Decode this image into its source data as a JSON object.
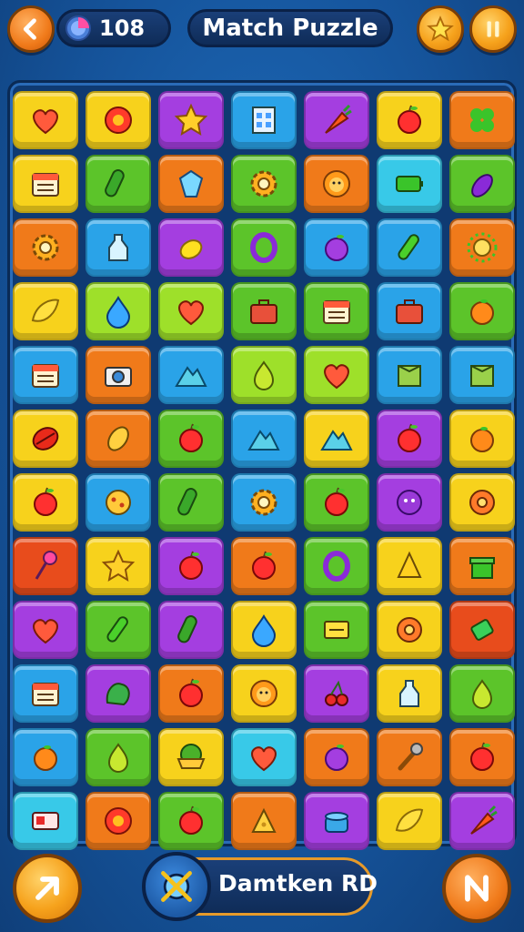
{
  "header": {
    "coins": "108",
    "title": "Match Puzzle"
  },
  "footer": {
    "player_name": "Damtken RD"
  },
  "colors": {
    "yellow": "#f7d21c",
    "orange": "#f07a1a",
    "purple": "#a43ee0",
    "blue": "#2aa3e8",
    "green": "#5cc42a",
    "red": "#e84c1c",
    "lime": "#9ee02a",
    "cyan": "#38c9e8"
  },
  "tiles": [
    [
      {
        "c": "yellow",
        "i": "heart-icon"
      },
      {
        "c": "yellow",
        "i": "flower-icon"
      },
      {
        "c": "purple",
        "i": "star-icon"
      },
      {
        "c": "blue",
        "i": "building-icon"
      },
      {
        "c": "purple",
        "i": "carrot-icon"
      },
      {
        "c": "yellow",
        "i": "apple-icon"
      },
      {
        "c": "orange",
        "i": "clover-icon"
      }
    ],
    [
      {
        "c": "yellow",
        "i": "calendar-icon"
      },
      {
        "c": "green",
        "i": "cucumber-icon"
      },
      {
        "c": "orange",
        "i": "gem-icon"
      },
      {
        "c": "green",
        "i": "gear-icon"
      },
      {
        "c": "orange",
        "i": "lion-icon"
      },
      {
        "c": "cyan",
        "i": "battery-icon"
      },
      {
        "c": "green",
        "i": "eggplant-icon"
      }
    ],
    [
      {
        "c": "orange",
        "i": "gear-icon"
      },
      {
        "c": "blue",
        "i": "bottle-icon"
      },
      {
        "c": "purple",
        "i": "lemon-icon"
      },
      {
        "c": "green",
        "i": "ring-icon"
      },
      {
        "c": "blue",
        "i": "plum-icon"
      },
      {
        "c": "blue",
        "i": "pepper-icon"
      },
      {
        "c": "orange",
        "i": "sun-icon"
      }
    ],
    [
      {
        "c": "yellow",
        "i": "leaf-icon"
      },
      {
        "c": "lime",
        "i": "drop-icon"
      },
      {
        "c": "lime",
        "i": "heart-icon"
      },
      {
        "c": "green",
        "i": "briefcase-icon"
      },
      {
        "c": "green",
        "i": "calendar-icon"
      },
      {
        "c": "blue",
        "i": "briefcase-icon"
      },
      {
        "c": "green",
        "i": "orange-icon"
      }
    ],
    [
      {
        "c": "blue",
        "i": "calendar-icon"
      },
      {
        "c": "orange",
        "i": "camera-icon"
      },
      {
        "c": "blue",
        "i": "mountain-icon"
      },
      {
        "c": "lime",
        "i": "pear-icon"
      },
      {
        "c": "lime",
        "i": "heart-icon"
      },
      {
        "c": "blue",
        "i": "box-icon"
      },
      {
        "c": "blue",
        "i": "box-icon"
      }
    ],
    [
      {
        "c": "yellow",
        "i": "shell-icon"
      },
      {
        "c": "orange",
        "i": "mango-icon"
      },
      {
        "c": "green",
        "i": "apple-icon"
      },
      {
        "c": "blue",
        "i": "mountain-icon"
      },
      {
        "c": "yellow",
        "i": "mountain-icon"
      },
      {
        "c": "purple",
        "i": "apple-icon"
      },
      {
        "c": "yellow",
        "i": "orange-icon"
      }
    ],
    [
      {
        "c": "yellow",
        "i": "apple-icon"
      },
      {
        "c": "blue",
        "i": "cookie-icon"
      },
      {
        "c": "green",
        "i": "cucumber-icon"
      },
      {
        "c": "blue",
        "i": "gear-icon"
      },
      {
        "c": "green",
        "i": "apple-icon"
      },
      {
        "c": "purple",
        "i": "face-icon"
      },
      {
        "c": "yellow",
        "i": "donut-icon"
      }
    ],
    [
      {
        "c": "red",
        "i": "pin-icon"
      },
      {
        "c": "yellow",
        "i": "star-icon"
      },
      {
        "c": "purple",
        "i": "apple-icon"
      },
      {
        "c": "orange",
        "i": "apple-icon"
      },
      {
        "c": "green",
        "i": "ring-icon"
      },
      {
        "c": "yellow",
        "i": "cone-icon"
      },
      {
        "c": "orange",
        "i": "gift-icon"
      }
    ],
    [
      {
        "c": "purple",
        "i": "heart-icon"
      },
      {
        "c": "green",
        "i": "pepper-icon"
      },
      {
        "c": "purple",
        "i": "cucumber-icon"
      },
      {
        "c": "yellow",
        "i": "drop-icon"
      },
      {
        "c": "green",
        "i": "label-icon"
      },
      {
        "c": "yellow",
        "i": "donut-icon"
      },
      {
        "c": "red",
        "i": "candy-icon"
      }
    ],
    [
      {
        "c": "blue",
        "i": "calendar-icon"
      },
      {
        "c": "purple",
        "i": "lettuce-icon"
      },
      {
        "c": "orange",
        "i": "apple-icon"
      },
      {
        "c": "yellow",
        "i": "lion-icon"
      },
      {
        "c": "purple",
        "i": "cherry-icon"
      },
      {
        "c": "yellow",
        "i": "bottle-icon"
      },
      {
        "c": "green",
        "i": "pear-icon"
      }
    ],
    [
      {
        "c": "blue",
        "i": "orange-icon"
      },
      {
        "c": "green",
        "i": "pear-icon"
      },
      {
        "c": "yellow",
        "i": "bowl-icon"
      },
      {
        "c": "cyan",
        "i": "heart-icon"
      },
      {
        "c": "orange",
        "i": "plum-icon"
      },
      {
        "c": "orange",
        "i": "wrench-icon"
      },
      {
        "c": "orange",
        "i": "apple-icon"
      }
    ],
    [
      {
        "c": "cyan",
        "i": "ticket-icon"
      },
      {
        "c": "orange",
        "i": "flower-icon"
      },
      {
        "c": "green",
        "i": "apple-icon"
      },
      {
        "c": "orange",
        "i": "cheese-icon"
      },
      {
        "c": "purple",
        "i": "pot-icon"
      },
      {
        "c": "yellow",
        "i": "leaf-icon"
      },
      {
        "c": "purple",
        "i": "carrot-icon"
      }
    ]
  ]
}
